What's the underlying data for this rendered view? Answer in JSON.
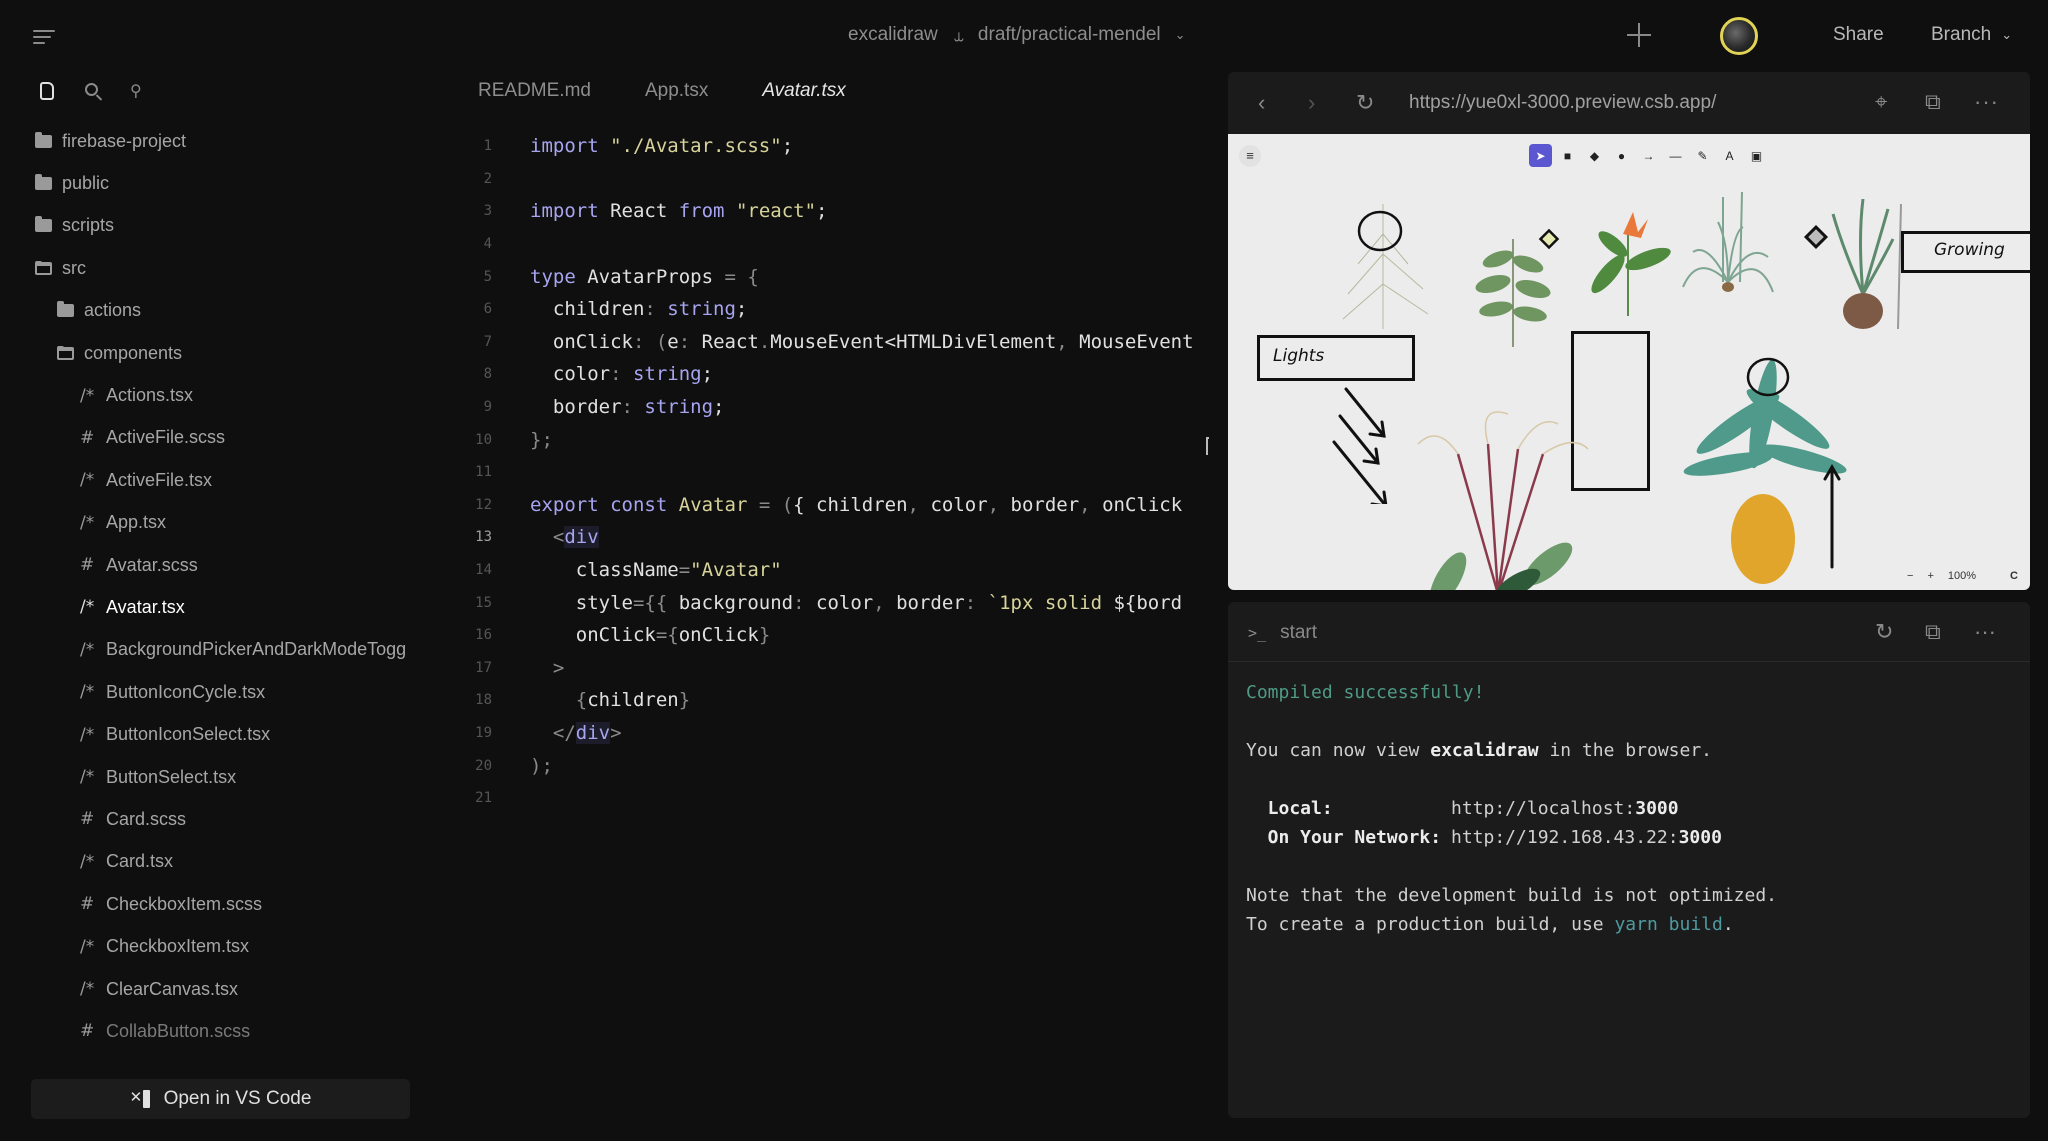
{
  "topbar": {
    "menu_icon": "hamburger-menu-icon",
    "repo": "excalidraw",
    "branch_icon": "git-branch-icon",
    "branch": "draft/practical-mendel",
    "add_icon": "plus-icon",
    "share_label": "Share",
    "branch_button_label": "Branch"
  },
  "sidebar": {
    "tabs": [
      {
        "name": "files",
        "icon": "file-icon"
      },
      {
        "name": "search",
        "icon": "search-icon"
      },
      {
        "name": "source-control",
        "icon": "git-icon"
      }
    ],
    "tree": [
      {
        "label": "firebase-project",
        "type": "folder",
        "level": 0
      },
      {
        "label": "public",
        "type": "folder",
        "level": 0
      },
      {
        "label": "scripts",
        "type": "folder",
        "level": 0
      },
      {
        "label": "src",
        "type": "folder-open",
        "level": 0
      },
      {
        "label": "actions",
        "type": "folder",
        "level": 1
      },
      {
        "label": "components",
        "type": "folder-open",
        "level": 1
      },
      {
        "label": "Actions.tsx",
        "type": "tsx",
        "level": 2
      },
      {
        "label": "ActiveFile.scss",
        "type": "scss",
        "level": 2
      },
      {
        "label": "ActiveFile.tsx",
        "type": "tsx",
        "level": 2
      },
      {
        "label": "App.tsx",
        "type": "tsx",
        "level": 2
      },
      {
        "label": "Avatar.scss",
        "type": "scss",
        "level": 2
      },
      {
        "label": "Avatar.tsx",
        "type": "tsx",
        "level": 2,
        "active": true
      },
      {
        "label": "BackgroundPickerAndDarkModeTogg",
        "type": "tsx",
        "level": 2
      },
      {
        "label": "ButtonIconCycle.tsx",
        "type": "tsx",
        "level": 2
      },
      {
        "label": "ButtonIconSelect.tsx",
        "type": "tsx",
        "level": 2
      },
      {
        "label": "ButtonSelect.tsx",
        "type": "tsx",
        "level": 2
      },
      {
        "label": "Card.scss",
        "type": "scss",
        "level": 2
      },
      {
        "label": "Card.tsx",
        "type": "tsx",
        "level": 2
      },
      {
        "label": "CheckboxItem.scss",
        "type": "scss",
        "level": 2
      },
      {
        "label": "CheckboxItem.tsx",
        "type": "tsx",
        "level": 2
      },
      {
        "label": "ClearCanvas.tsx",
        "type": "tsx",
        "level": 2
      },
      {
        "label": "CollabButton.scss",
        "type": "scss",
        "level": 2,
        "faded": true
      }
    ],
    "file_glyphs": {
      "tsx": "/*",
      "scss": "#"
    },
    "vscode_button_label": "Open in VS Code"
  },
  "editor": {
    "tabs": [
      {
        "label": "README.md",
        "active": false
      },
      {
        "label": "App.tsx",
        "active": false
      },
      {
        "label": "Avatar.tsx",
        "active": true
      }
    ],
    "current_line": 13,
    "lines": [
      [
        [
          "kw",
          "import"
        ],
        [
          "id",
          " "
        ],
        [
          "str",
          "\"./Avatar.scss\""
        ],
        [
          "id",
          ";"
        ]
      ],
      [],
      [
        [
          "kw",
          "import"
        ],
        [
          "id",
          " React "
        ],
        [
          "kw",
          "from"
        ],
        [
          "id",
          " "
        ],
        [
          "str",
          "\"react\""
        ],
        [
          "id",
          ";"
        ]
      ],
      [],
      [
        [
          "kw",
          "type"
        ],
        [
          "id",
          " AvatarProps "
        ],
        [
          "punc",
          "= {"
        ]
      ],
      [
        [
          "id",
          "  children"
        ],
        [
          "punc",
          ": "
        ],
        [
          "type",
          "string"
        ],
        [
          "id",
          ";"
        ]
      ],
      [
        [
          "id",
          "  onClick"
        ],
        [
          "punc",
          ": ("
        ],
        [
          "id",
          "e"
        ],
        [
          "punc",
          ": "
        ],
        [
          "id",
          "React"
        ],
        [
          "punc",
          "."
        ],
        [
          "id",
          "MouseEvent<HTMLDivElement"
        ],
        [
          "punc",
          ", "
        ],
        [
          "id",
          "MouseEvent"
        ]
      ],
      [
        [
          "id",
          "  color"
        ],
        [
          "punc",
          ": "
        ],
        [
          "type",
          "string"
        ],
        [
          "id",
          ";"
        ]
      ],
      [
        [
          "id",
          "  border"
        ],
        [
          "punc",
          ": "
        ],
        [
          "type",
          "string"
        ],
        [
          "id",
          ";"
        ]
      ],
      [
        [
          "punc",
          "};"
        ]
      ],
      [],
      [
        [
          "kw",
          "export"
        ],
        [
          "id",
          " "
        ],
        [
          "kw",
          "const"
        ],
        [
          "id",
          " "
        ],
        [
          "fn",
          "Avatar"
        ],
        [
          "punc",
          " = ("
        ],
        [
          "id",
          "{ children"
        ],
        [
          "punc",
          ", "
        ],
        [
          "id",
          "color"
        ],
        [
          "punc",
          ", "
        ],
        [
          "id",
          "border"
        ],
        [
          "punc",
          ", "
        ],
        [
          "id",
          "onClick"
        ]
      ],
      [
        [
          "punc",
          "  <"
        ],
        [
          "tag",
          "div"
        ]
      ],
      [
        [
          "id",
          "    className"
        ],
        [
          "punc",
          "="
        ],
        [
          "str",
          "\"Avatar\""
        ]
      ],
      [
        [
          "id",
          "    style"
        ],
        [
          "punc",
          "={{ "
        ],
        [
          "id",
          "background"
        ],
        [
          "punc",
          ": "
        ],
        [
          "id",
          "color"
        ],
        [
          "punc",
          ", "
        ],
        [
          "id",
          "border"
        ],
        [
          "punc",
          ": "
        ],
        [
          "str",
          "`1px solid "
        ],
        [
          "id",
          "${bord"
        ]
      ],
      [
        [
          "id",
          "    onClick"
        ],
        [
          "punc",
          "={"
        ],
        [
          "id",
          "onClick"
        ],
        [
          "punc",
          "}"
        ]
      ],
      [
        [
          "punc",
          "  >"
        ]
      ],
      [
        [
          "punc",
          "    {"
        ],
        [
          "id",
          "children"
        ],
        [
          "punc",
          "}"
        ]
      ],
      [
        [
          "punc",
          "  </"
        ],
        [
          "tag",
          "div"
        ],
        [
          "punc",
          ">"
        ]
      ],
      [
        [
          "punc",
          ");"
        ]
      ],
      []
    ]
  },
  "preview": {
    "back_icon": "chevron-left-icon",
    "forward_icon": "chevron-right-icon",
    "reload_icon": "reload-icon",
    "url": "https://yue0xl-3000.preview.csb.app/",
    "crosshair_icon": "crosshair-icon",
    "popout_icon": "open-in-new-window-icon",
    "more_icon": "more-icon",
    "canvas": {
      "menu_icon": "hamburger-menu-icon",
      "tools": [
        {
          "name": "selection",
          "glyph": "➤",
          "selected": true
        },
        {
          "name": "rectangle",
          "glyph": "■"
        },
        {
          "name": "diamond",
          "glyph": "◆"
        },
        {
          "name": "ellipse",
          "glyph": "●"
        },
        {
          "name": "arrow",
          "glyph": "→"
        },
        {
          "name": "line",
          "glyph": "—"
        },
        {
          "name": "draw",
          "glyph": "✎"
        },
        {
          "name": "text",
          "glyph": "A"
        },
        {
          "name": "image",
          "glyph": "▣"
        }
      ],
      "labels": {
        "lights": "Lights",
        "growing": "Growing"
      },
      "zoom": {
        "minus": "−",
        "plus": "+",
        "level": "100%",
        "reset": "C"
      }
    }
  },
  "terminal": {
    "title": "start",
    "prompt_icon": ">_",
    "lines": {
      "compiled": "Compiled successfully!",
      "view_prefix": "You can now view ",
      "view_app": "excalidraw",
      "view_suffix": " in the browser.",
      "local_label": "  Local:",
      "local_url_prefix": "http://localhost:",
      "local_port": "3000",
      "network_label": "  On Your Network:",
      "network_url_prefix": "http://192.168.43.22:",
      "network_port": "3000",
      "note": "Note that the development build is not optimized.",
      "create_prefix": "To create a production build, use ",
      "create_cmd": "yarn build",
      "create_suffix": "."
    }
  }
}
